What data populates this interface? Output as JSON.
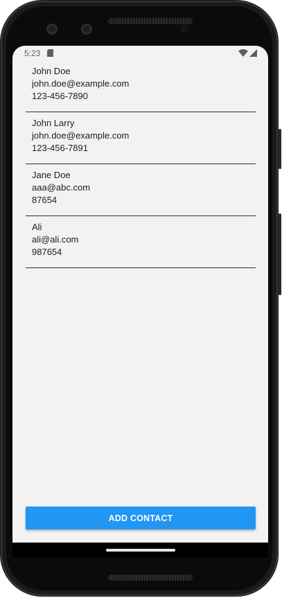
{
  "status_bar": {
    "time": "5:23",
    "icons": [
      "sd-card-icon",
      "wifi-icon",
      "cell-signal-icon"
    ]
  },
  "contacts": [
    {
      "name": "John Doe",
      "email": "john.doe@example.com",
      "phone": "123-456-7890"
    },
    {
      "name": "John Larry",
      "email": "john.doe@example.com",
      "phone": "123-456-7891"
    },
    {
      "name": "Jane Doe",
      "email": "aaa@abc.com",
      "phone": "87654"
    },
    {
      "name": "Ali",
      "email": "ali@ali.com",
      "phone": "987654"
    }
  ],
  "add_button": {
    "label": "ADD CONTACT"
  },
  "colors": {
    "screen_background": "#f2f2f2",
    "accent": "#2196f3",
    "text": "#202020",
    "divider": "#2d2d2d"
  }
}
